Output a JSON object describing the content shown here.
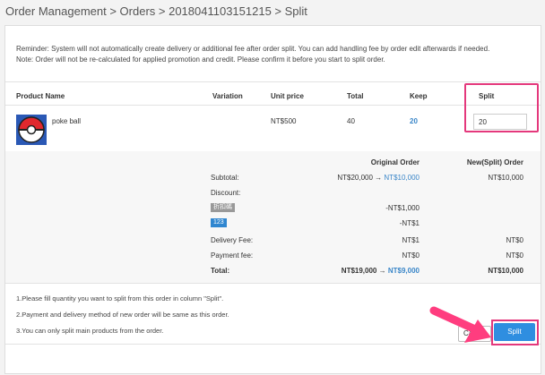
{
  "breadcrumb": "Order Management > Orders > 2018041103151215 > Split",
  "notice": {
    "line1": "Reminder: System will not automatically create delivery or additional fee after order split. You can add handling fee by order edit afterwards if needed.",
    "line2": "Note: Order will not be re-calculated for applied promotion and credit. Please confirm it before you start to split order."
  },
  "table": {
    "headers": {
      "product_name": "Product Name",
      "variation": "Variation",
      "unit_price": "Unit price",
      "total": "Total",
      "keep": "Keep",
      "split": "Split"
    },
    "row": {
      "product": "poke ball",
      "variation": "",
      "unit_price": "NT$500",
      "total": "40",
      "keep": "20",
      "split": "20"
    }
  },
  "summary": {
    "col_original": "Original Order",
    "col_new": "New(Split) Order",
    "subtotal_label": "Subtotal:",
    "subtotal_orig_from": "NT$20,000",
    "arrow": "→",
    "subtotal_orig_to": "NT$10,000",
    "subtotal_new": "NT$10,000",
    "discount_label": "Discount:",
    "discount_tag1": "折扣碼",
    "discount_tag1_value": "-NT$1,000",
    "discount_tag2": "123",
    "discount_tag2_value": "-NT$1",
    "delivery_label": "Delivery Fee:",
    "delivery_orig": "NT$1",
    "delivery_new": "NT$0",
    "payment_label": "Payment fee:",
    "payment_orig": "NT$0",
    "payment_new": "NT$0",
    "total_label": "Total:",
    "total_orig_from": "NT$19,000",
    "total_orig_to": "NT$9,000",
    "total_new": "NT$10,000"
  },
  "notes": [
    "1.Please fill quantity you want to split from this order in column \"Split\".",
    "2.Payment and delivery method of new order will be same as this order.",
    "3.You can only split main products from the order."
  ],
  "buttons": {
    "cancel": "Cancel",
    "split": "Split"
  },
  "colors": {
    "accent": "#2f8ee0",
    "highlight": "#e4387c",
    "link": "#3a86c8"
  }
}
